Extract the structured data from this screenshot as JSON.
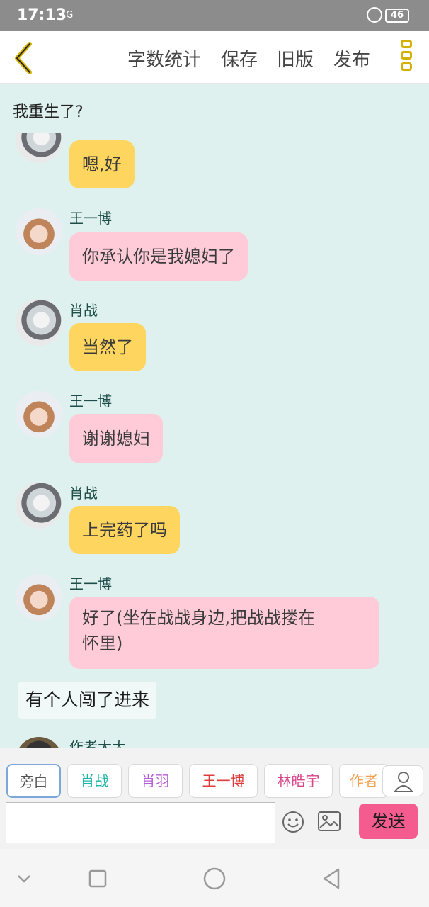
{
  "statusbar": {
    "time": "17:13",
    "signal": "4G",
    "battery": "46"
  },
  "toolbar": {
    "word_count": "字数统计",
    "save": "保存",
    "old_version": "旧版",
    "publish": "发布"
  },
  "chat_title": "我重生了?",
  "messages": [
    {
      "speaker": "",
      "text": "嗯,好"
    },
    {
      "speaker": "王一博",
      "text": "你承认你是我媳妇了"
    },
    {
      "speaker": "肖战",
      "text": "当然了"
    },
    {
      "speaker": "王一博",
      "text": "谢谢媳妇"
    },
    {
      "speaker": "肖战",
      "text": "上完药了吗"
    },
    {
      "speaker": "王一博",
      "text_line1": "好了(坐在战战身边,把战战搂在",
      "text_line2": "怀里)"
    },
    {
      "narration": "有个人闯了进来"
    },
    {
      "speaker": "作者大大"
    }
  ],
  "roles": [
    {
      "label": "旁白",
      "color": "#555555"
    },
    {
      "label": "肖战",
      "color": "#1bb5a7"
    },
    {
      "label": "肖羽",
      "color": "#b65ed6"
    },
    {
      "label": "王一博",
      "color": "#e03b3b"
    },
    {
      "label": "林皓宇",
      "color": "#d9458a"
    },
    {
      "label": "作者",
      "color": "#f0a050"
    }
  ],
  "input": {
    "value": ""
  },
  "send_label": "发送",
  "icons": [
    "back-chevron-icon",
    "more-dots-icon",
    "user-icon",
    "emoji-icon",
    "image-icon",
    "nav-down-icon",
    "nav-square-icon",
    "nav-circle-icon",
    "nav-back-triangle-icon"
  ]
}
